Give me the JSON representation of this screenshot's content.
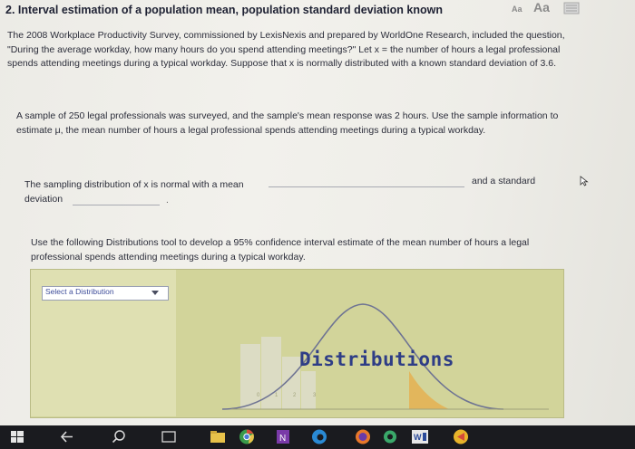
{
  "question": {
    "title": "2. Interval estimation of a population mean, population standard deviation known",
    "text_size_small": "Aa",
    "text_size_large": "Aa",
    "intro": "The 2008 Workplace Productivity Survey, commissioned by LexisNexis and prepared by WorldOne Research, included the question, \"During the average workday, how many hours do you spend attending meetings?\" Let x = the number of hours a legal professional spends attending meetings during a typical workday. Suppose that x is normally distributed with a known standard deviation of 3.6.",
    "sample": "A sample of 250 legal professionals was surveyed, and the sample's mean response was 2 hours. Use the sample information to estimate μ, the mean number of hours a legal professional spends attending meetings during a typical workday.",
    "sampling_left": "The sampling distribution of x is normal with a mean",
    "sampling_right": "and a standard",
    "sampling_deviation": "deviation",
    "sampling_end": ".",
    "instructions": "Use the following Distributions tool to develop a 95% confidence interval estimate of the mean number of hours a legal professional spends attending meetings during a typical workday."
  },
  "tool": {
    "select_label": "Select a Distribution",
    "banner": "Distributions",
    "axis_ticks": [
      "0",
      "1",
      "2",
      "3"
    ]
  },
  "colors": {
    "panel": "#d2d49a",
    "curve": "#6e7393",
    "shaded_tail": "#e2b65c",
    "banner_text": "#2e3d86"
  },
  "taskbar": {
    "icons": [
      "windows-icon",
      "back-icon",
      "search-icon",
      "task-view-icon",
      "file-explorer-icon",
      "chrome-icon",
      "onenote-icon",
      "edge-icon",
      "firefox-icon",
      "settings-icon",
      "word-icon",
      "app-icon"
    ]
  }
}
